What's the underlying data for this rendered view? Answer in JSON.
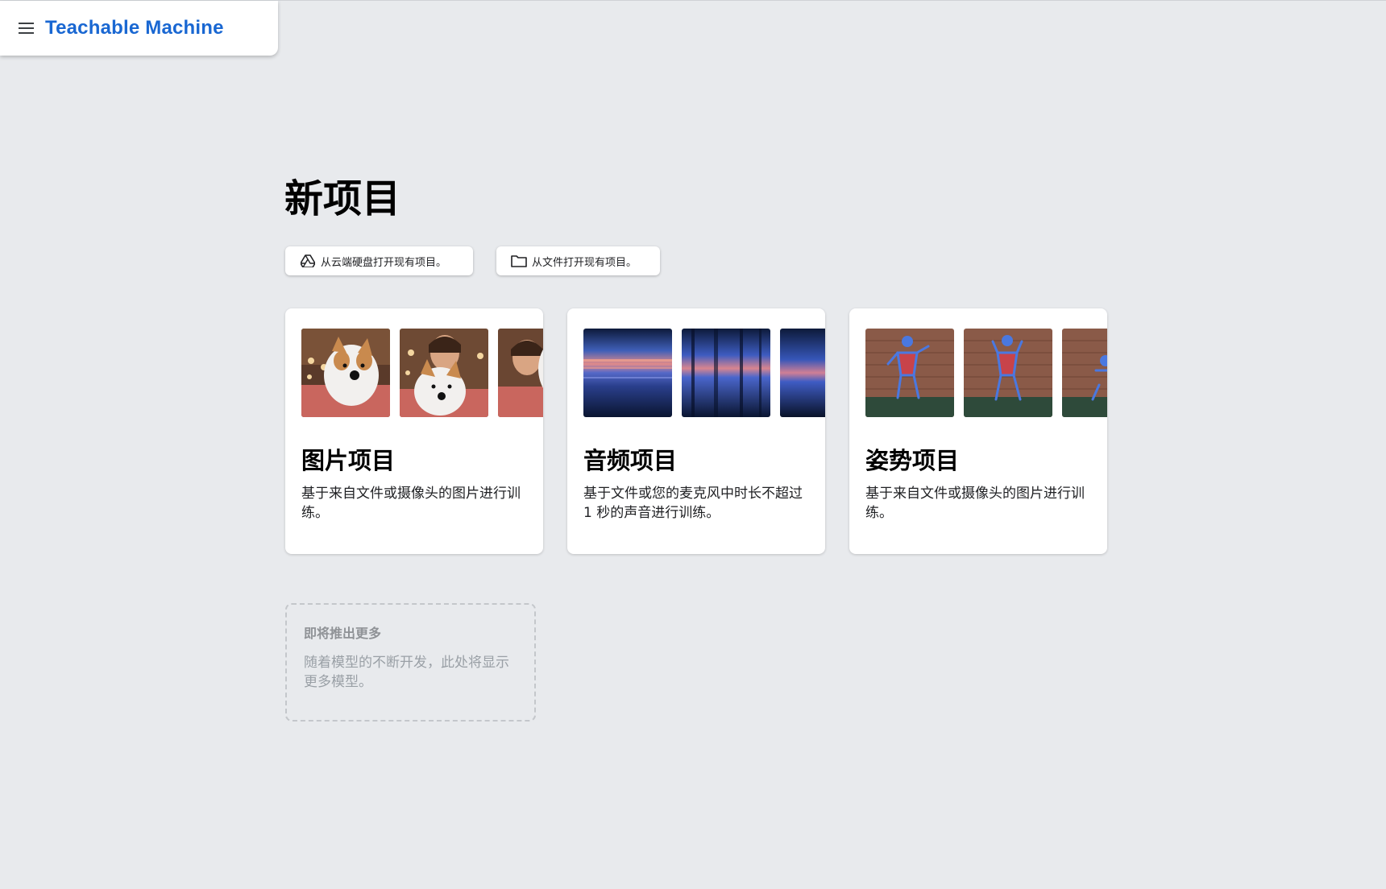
{
  "header": {
    "brand": "Teachable Machine",
    "menu_icon": "hamburger-menu-icon"
  },
  "main": {
    "title": "新项目",
    "open_buttons": [
      {
        "label": "从云端硬盘打开现有项目。",
        "icon": "google-drive-icon"
      },
      {
        "label": "从文件打开现有项目。",
        "icon": "folder-icon"
      }
    ],
    "cards": [
      {
        "title": "图片项目",
        "description": "基于来自文件或摄像头的图片进行训练。"
      },
      {
        "title": "音频项目",
        "description": "基于文件或您的麦克风中时长不超过 1 秒的声音进行训练。"
      },
      {
        "title": "姿势项目",
        "description": "基于来自文件或摄像头的图片进行训练。"
      }
    ],
    "coming_soon": {
      "title": "即将推出更多",
      "description": "随着模型的不断开发，此处将显示更多模型。"
    }
  },
  "colors": {
    "background": "#e8eaed",
    "brand": "#1967d2",
    "card": "#ffffff"
  }
}
